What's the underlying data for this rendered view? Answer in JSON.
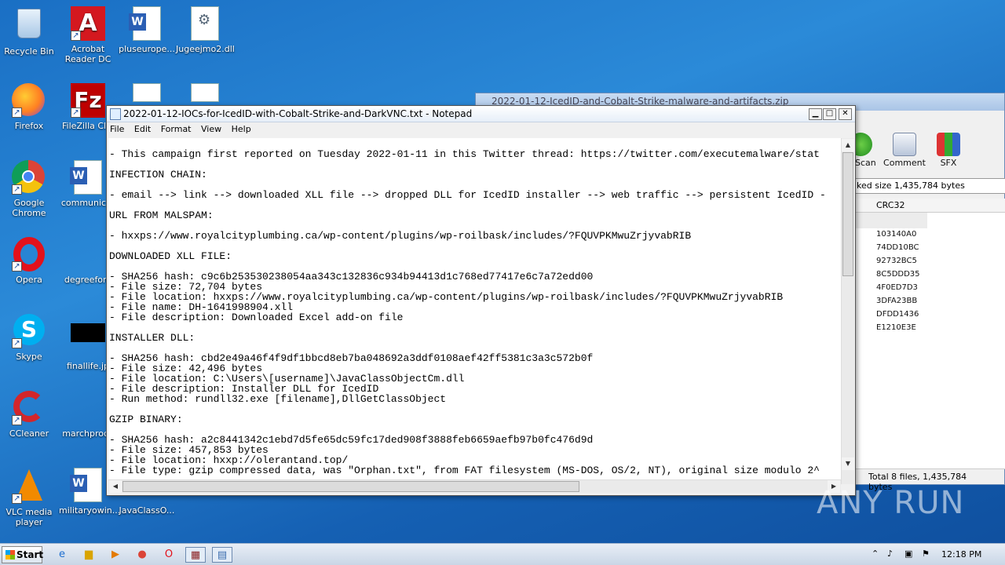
{
  "desktop": {
    "icons": [
      {
        "label": "Recycle Bin"
      },
      {
        "label": "Acrobat\nReader DC"
      },
      {
        "label": "pluseurope..."
      },
      {
        "label": "Jugeejmo2.dll"
      },
      {
        "label": "Firefox"
      },
      {
        "label": "FileZilla Clie"
      },
      {
        "label": "Google\nChrome"
      },
      {
        "label": "communicat"
      },
      {
        "label": "Opera"
      },
      {
        "label": "degreefore"
      },
      {
        "label": "Skype"
      },
      {
        "label": "finallife.jp"
      },
      {
        "label": "CCleaner"
      },
      {
        "label": "marchproce"
      },
      {
        "label": "VLC media\nplayer"
      },
      {
        "label": "militaryowin..."
      },
      {
        "label": "JavaClassO..."
      }
    ]
  },
  "winrar": {
    "title": "2022-01-12-IcedID-and-Cobalt-Strike-malware-and-artifacts.zip",
    "tools": [
      "usScan",
      "Comment",
      "SFX"
    ],
    "path_text": "ked size 1,435,784 bytes",
    "crc_header": "CRC32",
    "crc_values": [
      "103140A0",
      "74DD10BC",
      "92732BC5",
      "8C5DDD35",
      "4F0ED7D3",
      "3DFA23BB",
      "DFDD1436",
      "E1210E3E"
    ],
    "status": "Total 8 files, 1,435,784 bytes"
  },
  "notepad": {
    "title": "2022-01-12-IOCs-for-IcedID-with-Cobalt-Strike-and-DarkVNC.txt - Notepad",
    "menu": [
      "File",
      "Edit",
      "Format",
      "View",
      "Help"
    ],
    "content": "- This campaign first reported on Tuesday 2022-01-11 in this Twitter thread: https://twitter.com/executemalware/stat\n\nINFECTION CHAIN:\n\n- email --> link --> downloaded XLL file --> dropped DLL for IcedID installer --> web traffic --> persistent IcedID -\n\nURL FROM MALSPAM:\n\n- hxxps://www.royalcityplumbing.ca/wp-content/plugins/wp-roilbask/includes/?FQUVPKMwuZrjyvabRIB\n\nDOWNLOADED XLL FILE:\n\n- SHA256 hash: c9c6b253530238054aa343c132836c934b94413d1c768ed77417e6c7a72edd00\n- File size: 72,704 bytes\n- File location: hxxps://www.royalcityplumbing.ca/wp-content/plugins/wp-roilbask/includes/?FQUVPKMwuZrjyvabRIB\n- File name: DH-1641998904.xll\n- File description: Downloaded Excel add-on file\n\nINSTALLER DLL:\n\n- SHA256 hash: cbd2e49a46f4f9df1bbcd8eb7ba048692a3ddf0108aef42ff5381c3a3c572b0f\n- File size: 42,496 bytes\n- File location: C:\\Users\\[username]\\JavaClassObjectCm.dll\n- File description: Installer DLL for IcedID\n- Run method: rundll32.exe [filename],DllGetClassObject\n\nGZIP BINARY:\n\n- SHA256 hash: a2c8441342c1ebd7d5fe65dc59fc17ded908f3888feb6659aefb97b0fc476d9d\n- File size: 457,853 bytes\n- File location: hxxp://olerantand.top/\n- File type: gzip compressed data, was \"Orphan.txt\", from FAT filesystem (MS-DOS, OS/2, NT), original size modulo 2^"
  },
  "watermark": "ANY RUN",
  "taskbar": {
    "start_label": "Start",
    "clock": "12:18 PM"
  }
}
